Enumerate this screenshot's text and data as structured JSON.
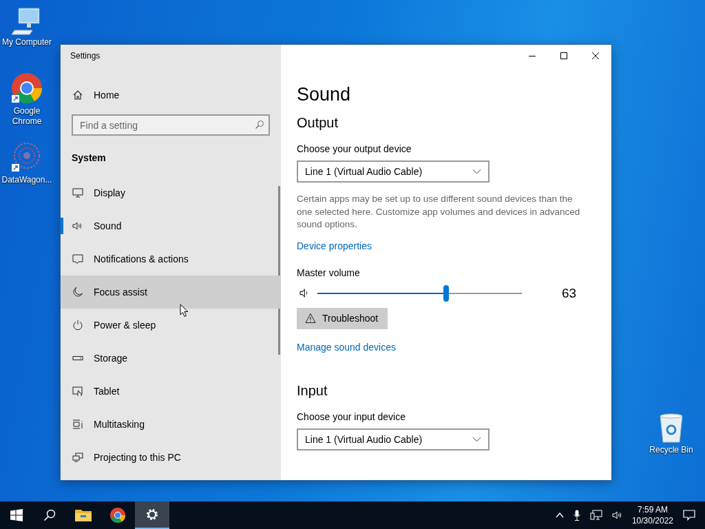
{
  "desktop_icons": [
    {
      "label": "My Computer"
    },
    {
      "label": "Google Chrome"
    },
    {
      "label": "DataWagon..."
    },
    {
      "label": "Recycle Bin"
    }
  ],
  "window": {
    "title": "Settings"
  },
  "sidebar": {
    "home": "Home",
    "search": {
      "placeholder": "Find a setting"
    },
    "section": "System",
    "items": [
      {
        "label": "Display",
        "selected": false,
        "hovered": false
      },
      {
        "label": "Sound",
        "selected": true,
        "hovered": false
      },
      {
        "label": "Notifications & actions",
        "selected": false,
        "hovered": false
      },
      {
        "label": "Focus assist",
        "selected": false,
        "hovered": true
      },
      {
        "label": "Power & sleep",
        "selected": false,
        "hovered": false
      },
      {
        "label": "Storage",
        "selected": false,
        "hovered": false
      },
      {
        "label": "Tablet",
        "selected": false,
        "hovered": false
      },
      {
        "label": "Multitasking",
        "selected": false,
        "hovered": false
      },
      {
        "label": "Projecting to this PC",
        "selected": false,
        "hovered": false
      }
    ]
  },
  "content": {
    "title": "Sound",
    "output": {
      "heading": "Output",
      "device_label": "Choose your output device",
      "device": "Line 1 (Virtual Audio Cable)",
      "description": "Certain apps may be set up to use different sound devices than the one selected here. Customize app volumes and devices in advanced sound options.",
      "device_properties_link": "Device properties",
      "volume_label": "Master volume",
      "volume": {
        "level": 0.63,
        "reading": "63"
      },
      "troubleshoot": "Troubleshoot",
      "manage_link": "Manage sound devices"
    },
    "input": {
      "heading": "Input",
      "device_label": "Choose your input device",
      "device": "Line 1 (Virtual Audio Cable)"
    }
  },
  "taskbar": {
    "apps": [
      {
        "kind": "explorer",
        "selected": false
      },
      {
        "kind": "chrome",
        "selected": false
      },
      {
        "kind": "settings",
        "selected": true
      }
    ],
    "time": "7:59 AM",
    "date": "10/30/2022"
  }
}
